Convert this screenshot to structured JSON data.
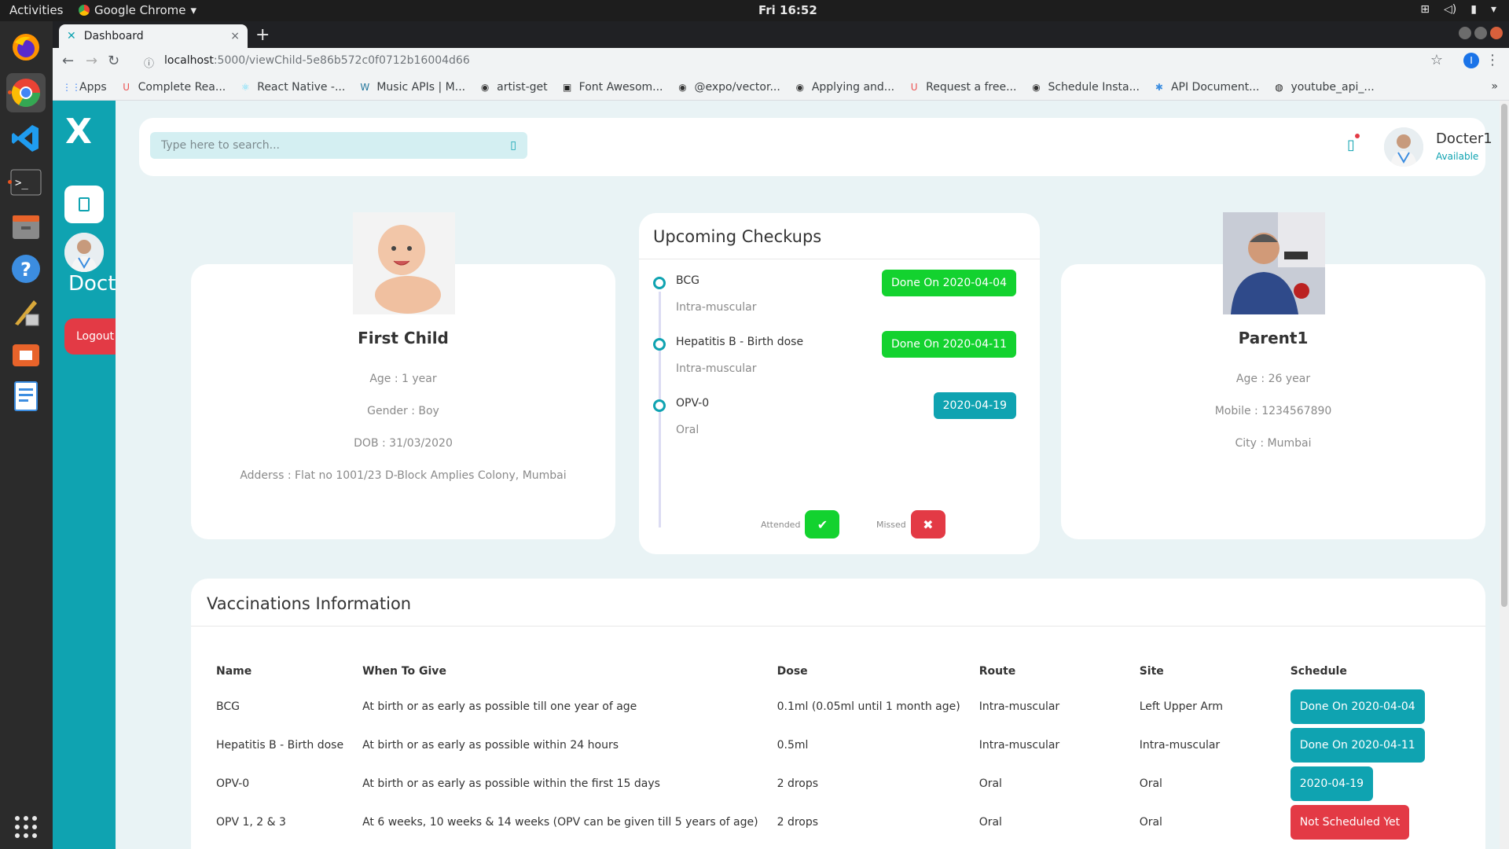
{
  "system": {
    "activities": "Activities",
    "app_name": "Google Chrome",
    "clock": "Fri 16:52"
  },
  "browser": {
    "tab_title": "Dashboard",
    "url_host": "localhost",
    "url_path": ":5000/viewChild-5e86b572c0f0712b16004d66",
    "profile_initial": "I",
    "bookmarks": [
      {
        "label": "Apps",
        "icon": "apps-grid-icon"
      },
      {
        "label": "Complete Rea...",
        "icon": "udemy-icon"
      },
      {
        "label": "React Native -...",
        "icon": "react-icon"
      },
      {
        "label": "Music APIs | M...",
        "icon": "wordpress-icon"
      },
      {
        "label": "artist-get",
        "icon": "globe-icon"
      },
      {
        "label": "Font Awesom...",
        "icon": "flag-icon"
      },
      {
        "label": "@expo/vector...",
        "icon": "globe-icon"
      },
      {
        "label": "Applying and...",
        "icon": "globe-icon"
      },
      {
        "label": "Request a free...",
        "icon": "udemy-icon"
      },
      {
        "label": "Schedule Insta...",
        "icon": "globe-icon"
      },
      {
        "label": "API Document...",
        "icon": "snowflake-icon"
      },
      {
        "label": "youtube_api_...",
        "icon": "github-icon"
      }
    ]
  },
  "sidebar": {
    "logo": "X",
    "user_short": "Doct",
    "logout_label": "Logout"
  },
  "header": {
    "search_placeholder": "Type here to search...",
    "doctor_name": "Docter1",
    "doctor_status": "Available"
  },
  "child": {
    "name": "First Child",
    "age": "Age : 1 year",
    "gender": "Gender : Boy",
    "dob": "DOB : 31/03/2020",
    "address": "Adderss : Flat no 1001/23 D-Block Amplies Colony, Mumbai"
  },
  "parent": {
    "name": "Parent1",
    "age": "Age : 26 year",
    "mobile": "Mobile : 1234567890",
    "city": "City : Mumbai"
  },
  "checkups": {
    "title": "Upcoming Checkups",
    "items": [
      {
        "name": "BCG",
        "route": "Intra-muscular",
        "status": "Done On 2020-04-04",
        "color": "#13d22f"
      },
      {
        "name": "Hepatitis B - Birth dose",
        "route": "Intra-muscular",
        "status": "Done On 2020-04-11",
        "color": "#13d22f"
      },
      {
        "name": "OPV-0",
        "route": "Oral",
        "status": "2020-04-19",
        "color": "#0fa3b1"
      }
    ],
    "legend_attended": "Attended",
    "legend_missed": "Missed"
  },
  "vaccinations": {
    "title": "Vaccinations Information",
    "columns": [
      "Name",
      "When To Give",
      "Dose",
      "Route",
      "Site",
      "Schedule"
    ],
    "rows": [
      {
        "name": "BCG",
        "when": "At birth or as early as possible till one year of age",
        "dose": "0.1ml (0.05ml until 1 month age)",
        "route": "Intra-muscular",
        "site": "Left Upper Arm",
        "schedule": "Done On 2020-04-04",
        "color": "#0fa3b1"
      },
      {
        "name": "Hepatitis B - Birth dose",
        "when": "At birth or as early as possible within 24 hours",
        "dose": "0.5ml",
        "route": "Intra-muscular",
        "site": "Intra-muscular",
        "schedule": "Done On 2020-04-11",
        "color": "#0fa3b1"
      },
      {
        "name": "OPV-0",
        "when": "At birth or as early as possible within the first 15 days",
        "dose": "2 drops",
        "route": "Oral",
        "site": "Oral",
        "schedule": "2020-04-19",
        "color": "#0fa3b1"
      },
      {
        "name": "OPV 1, 2 & 3",
        "when": "At 6 weeks, 10 weeks & 14 weeks (OPV can be given till 5 years of age)",
        "dose": "2 drops",
        "route": "Oral",
        "site": "Oral",
        "schedule": "Not Scheduled Yet",
        "color": "#e33a45"
      }
    ]
  },
  "colors": {
    "accent": "#0fa3b1",
    "success": "#13d22f",
    "danger": "#e33a45",
    "background": "#e9f3f5"
  }
}
